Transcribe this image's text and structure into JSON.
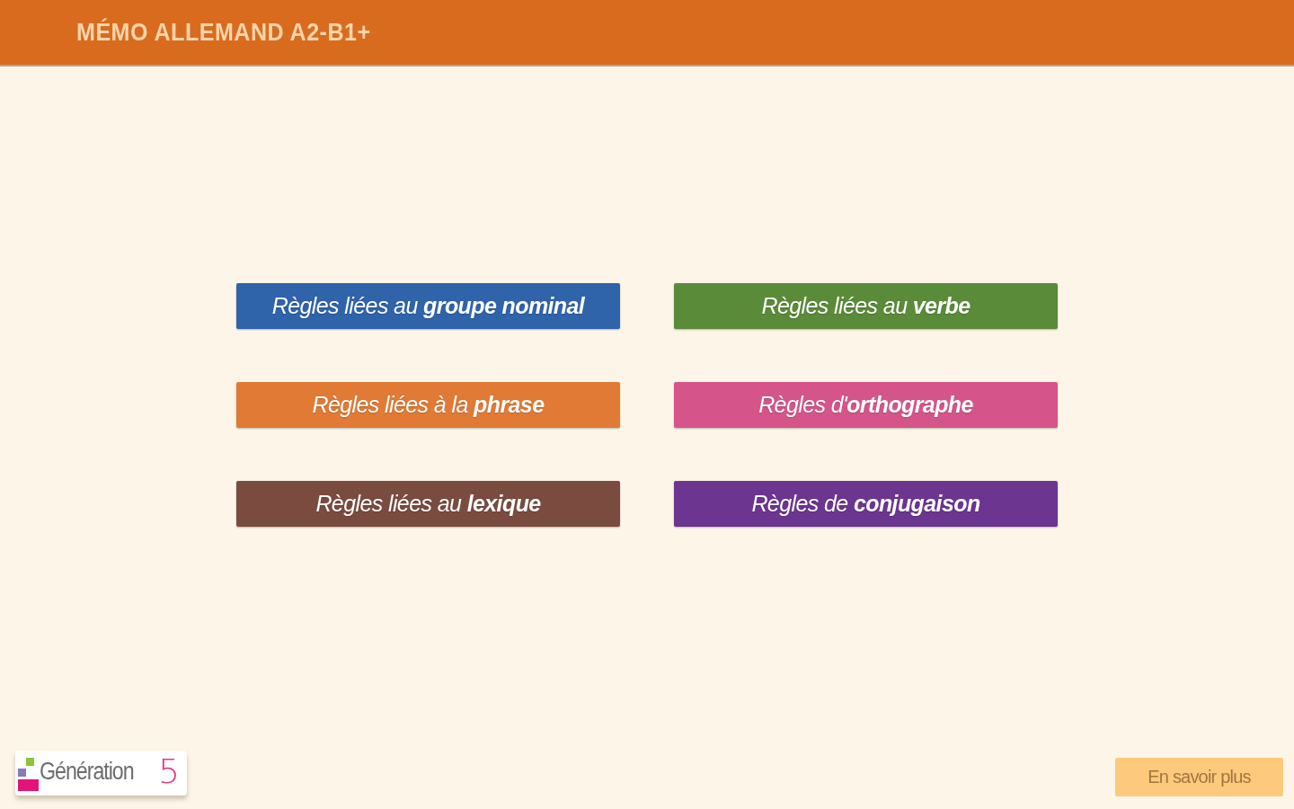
{
  "header": {
    "title": "MÉMO ALLEMAND A2-B1+"
  },
  "topics": [
    {
      "label": "Règles liées au **groupe nominal**",
      "color": "#2f63aa"
    },
    {
      "label": "Règles liées au **verbe**",
      "color": "#5a8b39"
    },
    {
      "label": "Règles liées à la **phrase**",
      "color": "#e07a35"
    },
    {
      "label": "Règles d'**orthographe**",
      "color": "#d5558a"
    },
    {
      "label": "Règles liées au **lexique**",
      "color": "#7a4b3f"
    },
    {
      "label": "Règles de **conjugaison**",
      "color": "#6b3590"
    }
  ],
  "footer": {
    "logo": {
      "name": "Génération",
      "number": "5"
    },
    "more_button": "En savoir plus"
  }
}
